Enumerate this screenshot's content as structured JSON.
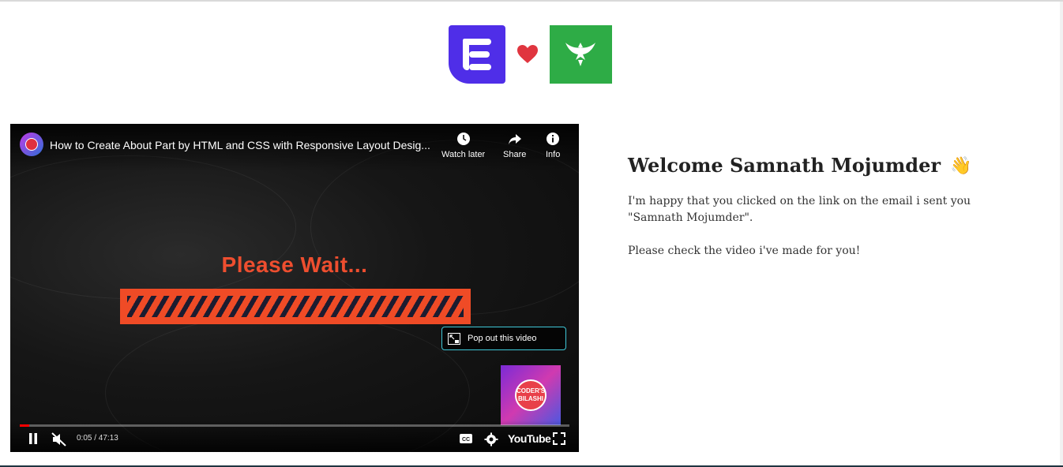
{
  "video": {
    "title": "How to Create About Part by HTML and CSS with Responsive Layout Desig...",
    "watch_later_label": "Watch later",
    "share_label": "Share",
    "info_label": "Info",
    "please_wait_text": "Please Wait...",
    "popout_label": "Pop out this video",
    "time_display": "0:05 / 47:13",
    "youtube_label": "YouTube",
    "thumbnail_text": "CODER'S BILASHI",
    "channel_badge_text": "CODER'S",
    "progress_fraction": 0.0018
  },
  "content": {
    "heading": "Welcome Samnath Mojumder",
    "paragraph_1": "I'm happy that you clicked on the link on the email i sent you \"Samnath Mojumder\".",
    "paragraph_2": "Please check the video i've made for you!"
  },
  "colors": {
    "brand_purple": "#4f2ee8",
    "brand_green": "#2eac46",
    "heart_red": "#e0353f",
    "loading_orange": "#ef4b26",
    "popout_border": "#3fc8d8"
  },
  "icons": [
    "e-logo-icon",
    "heart-icon",
    "phoenix-logo-icon",
    "clock-icon",
    "share-icon",
    "info-icon",
    "pause-icon",
    "mute-icon",
    "captions-icon",
    "settings-icon",
    "fullscreen-icon",
    "popout-icon",
    "waving-hand-icon"
  ]
}
